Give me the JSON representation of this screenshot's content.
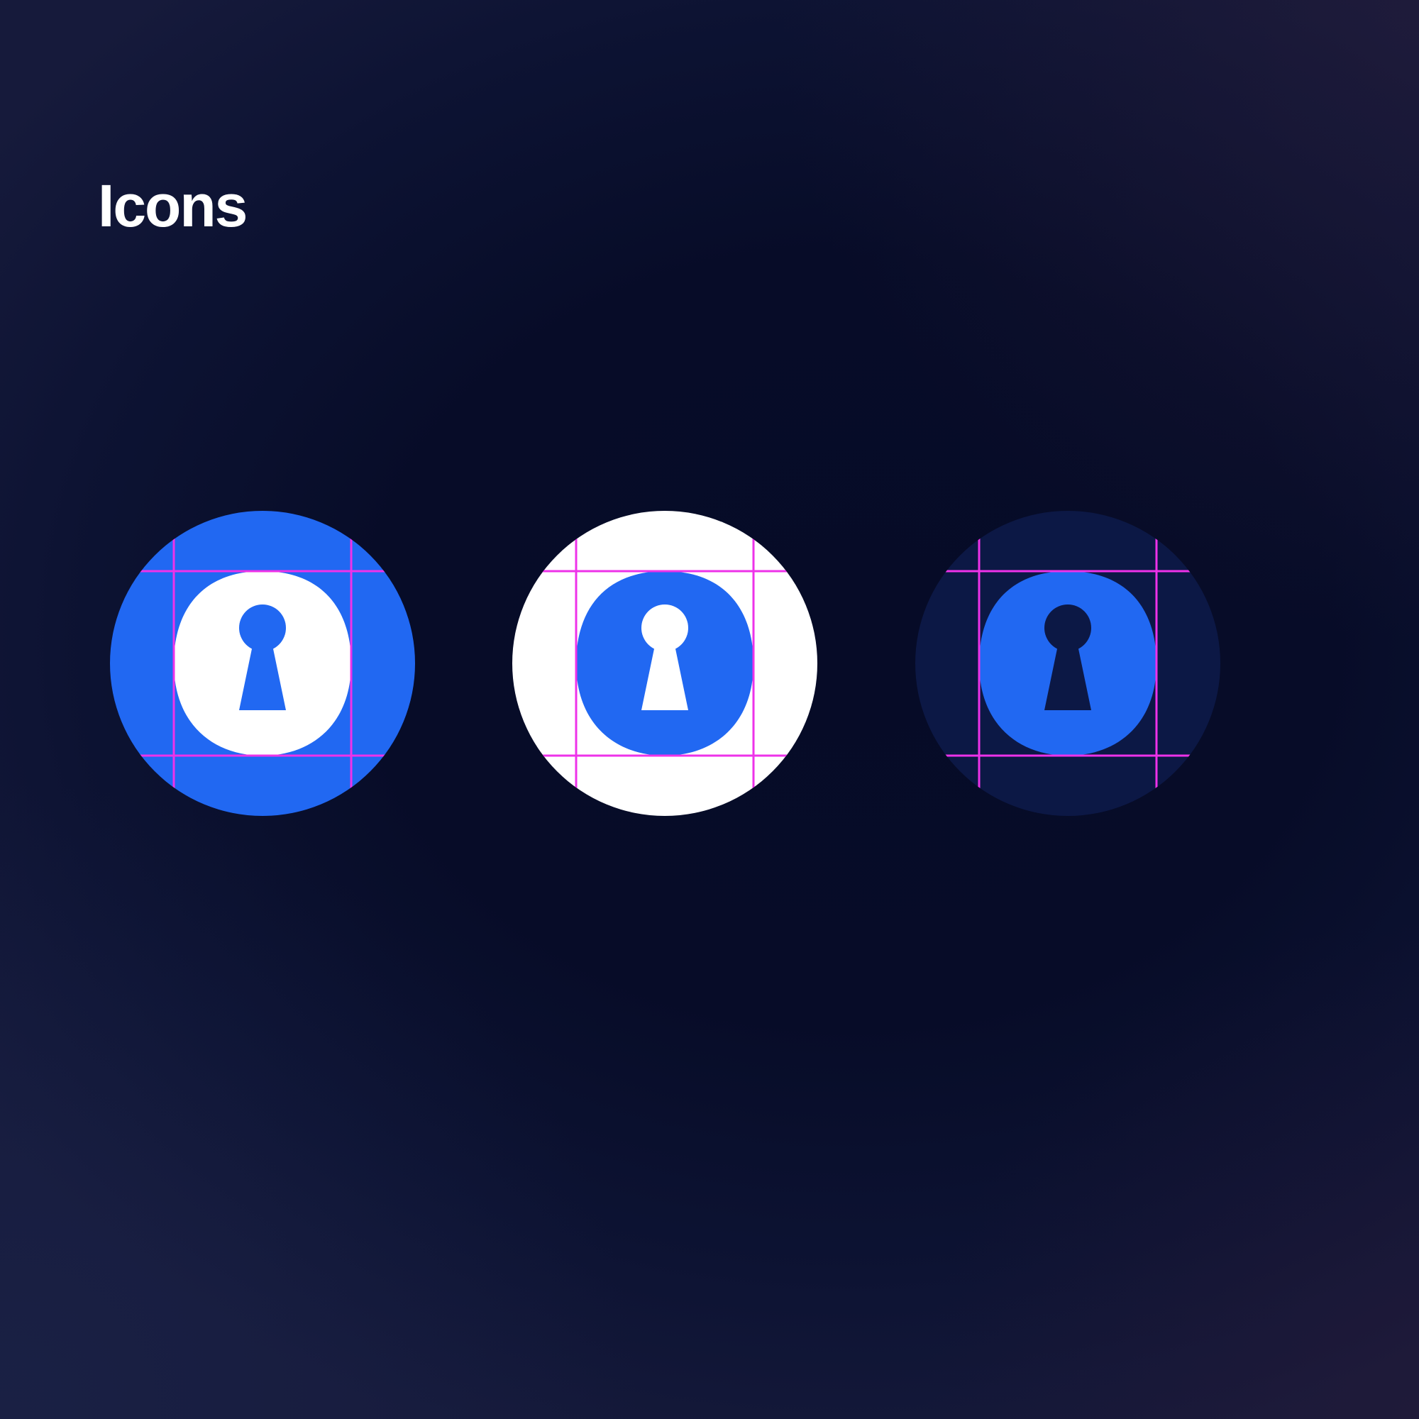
{
  "page": {
    "title": "Icons"
  },
  "colors": {
    "blue": "#2168f2",
    "white": "#ffffff",
    "navy": "#0c1845",
    "guide": "#ee32e9",
    "background": "#070b25"
  },
  "icons": [
    {
      "name": "keyhole-icon",
      "variant": "blue-background",
      "background": "#2168f2",
      "shape": "#ffffff",
      "keyhole": "#2168f2",
      "guides": true
    },
    {
      "name": "keyhole-icon",
      "variant": "white-background",
      "background": "#ffffff",
      "shape": "#2168f2",
      "keyhole": "#ffffff",
      "guides": true
    },
    {
      "name": "keyhole-icon",
      "variant": "navy-background",
      "background": "#0c1845",
      "shape": "#2168f2",
      "keyhole": "#0c1845",
      "guides": true
    }
  ]
}
